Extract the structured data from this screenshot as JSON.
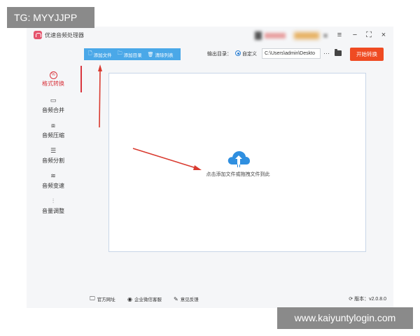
{
  "watermarks": {
    "top_left": "TG: MYYJJPP",
    "bottom_right": "www.kaiyuntylogin.com"
  },
  "window": {
    "title": "优速音频处理器",
    "controls": {
      "menu": "≡",
      "minimize": "−",
      "maximize": "⛶",
      "close": "×"
    }
  },
  "sidebar": {
    "items": [
      {
        "label": "格式转换",
        "icon": "format-convert-icon",
        "active": true
      },
      {
        "label": "音频合并",
        "icon": "merge-icon"
      },
      {
        "label": "音频压缩",
        "icon": "compress-icon"
      },
      {
        "label": "音频分割",
        "icon": "split-icon"
      },
      {
        "label": "音频变速",
        "icon": "speed-icon"
      },
      {
        "label": "音量调整",
        "icon": "volume-icon"
      }
    ]
  },
  "toolbar": {
    "add_file": "添加文件",
    "add_folder": "添加目录",
    "clear_list": "清除列表"
  },
  "output": {
    "label": "输出目录：",
    "option": "自定义",
    "path": "C:\\Users\\admin\\Deskto",
    "more": "···",
    "start_button": "开始转换"
  },
  "drop_area": {
    "hint": "点击添加文件或拖拽文件到此"
  },
  "footer": {
    "website": "官方网址",
    "support": "企业微信客服",
    "feedback": "意见反馈",
    "version": "版本：v2.0.8.0"
  },
  "colors": {
    "accent_red": "#d9363e",
    "toolbar_blue": "#4aa8e8",
    "start_orange": "#ef4b22",
    "cloud_blue": "#2f8fe0",
    "annotation_red": "#d93a2f"
  }
}
